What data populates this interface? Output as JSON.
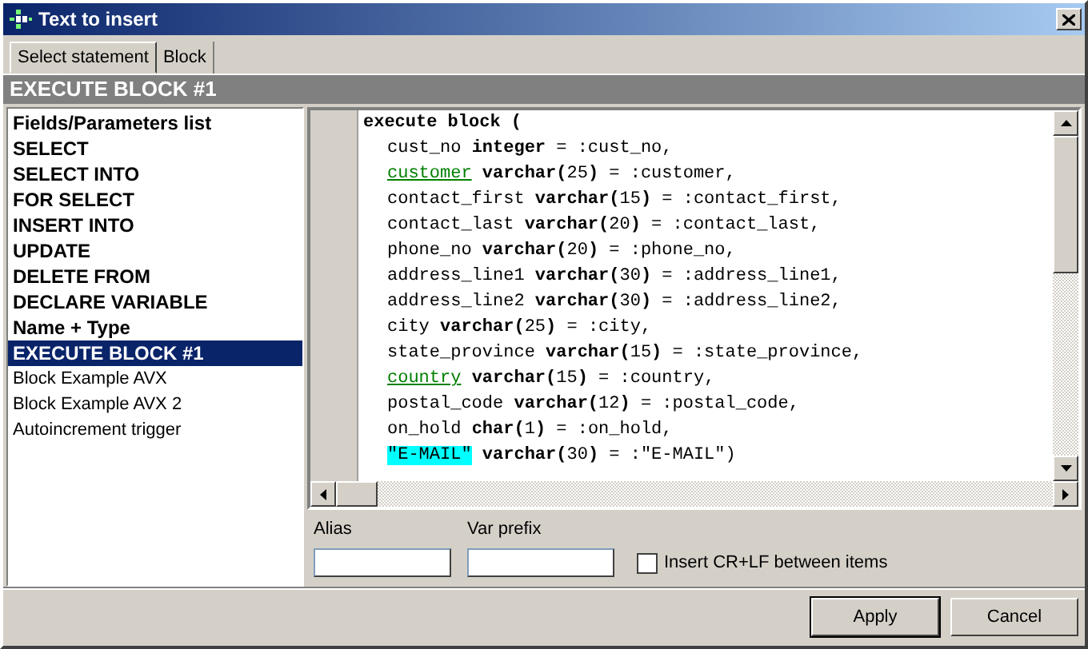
{
  "window": {
    "title": "Text to insert"
  },
  "tabs": [
    {
      "label": "Select statement",
      "selected": true
    },
    {
      "label": "Block",
      "selected": false
    }
  ],
  "header": "EXECUTE BLOCK #1",
  "templates": [
    {
      "label": "Fields/Parameters list",
      "kind": "builtin",
      "selected": false
    },
    {
      "label": "SELECT",
      "kind": "builtin",
      "selected": false
    },
    {
      "label": "SELECT INTO",
      "kind": "builtin",
      "selected": false
    },
    {
      "label": "FOR SELECT",
      "kind": "builtin",
      "selected": false
    },
    {
      "label": "INSERT INTO",
      "kind": "builtin",
      "selected": false
    },
    {
      "label": "UPDATE",
      "kind": "builtin",
      "selected": false
    },
    {
      "label": "DELETE FROM",
      "kind": "builtin",
      "selected": false
    },
    {
      "label": "DECLARE VARIABLE",
      "kind": "builtin",
      "selected": false
    },
    {
      "label": "Name + Type",
      "kind": "builtin",
      "selected": false
    },
    {
      "label": "EXECUTE BLOCK #1",
      "kind": "builtin",
      "selected": true
    },
    {
      "label": "Block Example AVX",
      "kind": "user",
      "selected": false
    },
    {
      "label": "Block Example AVX 2",
      "kind": "user",
      "selected": false
    },
    {
      "label": "Autoincrement trigger",
      "kind": "user",
      "selected": false
    }
  ],
  "code_lines": [
    {
      "indent": false,
      "parts": [
        {
          "kind": "keyword",
          "text": "execute block ("
        }
      ]
    },
    {
      "indent": true,
      "parts": [
        {
          "kind": "plain",
          "text": "cust_no "
        },
        {
          "kind": "keyword",
          "text": "integer"
        },
        {
          "kind": "plain",
          "text": " = :cust_no,"
        }
      ]
    },
    {
      "indent": true,
      "parts": [
        {
          "kind": "field",
          "text": "customer"
        },
        {
          "kind": "keyword",
          "text": " varchar("
        },
        {
          "kind": "plain",
          "text": "25"
        },
        {
          "kind": "keyword",
          "text": ")"
        },
        {
          "kind": "plain",
          "text": " = :customer,"
        }
      ]
    },
    {
      "indent": true,
      "parts": [
        {
          "kind": "plain",
          "text": "contact_first "
        },
        {
          "kind": "keyword",
          "text": "varchar("
        },
        {
          "kind": "plain",
          "text": "15"
        },
        {
          "kind": "keyword",
          "text": ")"
        },
        {
          "kind": "plain",
          "text": " = :contact_first,"
        }
      ]
    },
    {
      "indent": true,
      "parts": [
        {
          "kind": "plain",
          "text": "contact_last "
        },
        {
          "kind": "keyword",
          "text": "varchar("
        },
        {
          "kind": "plain",
          "text": "20"
        },
        {
          "kind": "keyword",
          "text": ")"
        },
        {
          "kind": "plain",
          "text": " = :contact_last,"
        }
      ]
    },
    {
      "indent": true,
      "parts": [
        {
          "kind": "plain",
          "text": "phone_no "
        },
        {
          "kind": "keyword",
          "text": "varchar("
        },
        {
          "kind": "plain",
          "text": "20"
        },
        {
          "kind": "keyword",
          "text": ")"
        },
        {
          "kind": "plain",
          "text": " = :phone_no,"
        }
      ]
    },
    {
      "indent": true,
      "parts": [
        {
          "kind": "plain",
          "text": "address_line1 "
        },
        {
          "kind": "keyword",
          "text": "varchar("
        },
        {
          "kind": "plain",
          "text": "30"
        },
        {
          "kind": "keyword",
          "text": ")"
        },
        {
          "kind": "plain",
          "text": " = :address_line1,"
        }
      ]
    },
    {
      "indent": true,
      "parts": [
        {
          "kind": "plain",
          "text": "address_line2 "
        },
        {
          "kind": "keyword",
          "text": "varchar("
        },
        {
          "kind": "plain",
          "text": "30"
        },
        {
          "kind": "keyword",
          "text": ")"
        },
        {
          "kind": "plain",
          "text": " = :address_line2,"
        }
      ]
    },
    {
      "indent": true,
      "parts": [
        {
          "kind": "plain",
          "text": "city "
        },
        {
          "kind": "keyword",
          "text": "varchar("
        },
        {
          "kind": "plain",
          "text": "25"
        },
        {
          "kind": "keyword",
          "text": ")"
        },
        {
          "kind": "plain",
          "text": " = :city,"
        }
      ]
    },
    {
      "indent": true,
      "parts": [
        {
          "kind": "plain",
          "text": "state_province "
        },
        {
          "kind": "keyword",
          "text": "varchar("
        },
        {
          "kind": "plain",
          "text": "15"
        },
        {
          "kind": "keyword",
          "text": ")"
        },
        {
          "kind": "plain",
          "text": " = :state_province,"
        }
      ]
    },
    {
      "indent": true,
      "parts": [
        {
          "kind": "field",
          "text": "country"
        },
        {
          "kind": "keyword",
          "text": " varchar("
        },
        {
          "kind": "plain",
          "text": "15"
        },
        {
          "kind": "keyword",
          "text": ")"
        },
        {
          "kind": "plain",
          "text": " = :country,"
        }
      ]
    },
    {
      "indent": true,
      "parts": [
        {
          "kind": "plain",
          "text": "postal_code "
        },
        {
          "kind": "keyword",
          "text": "varchar("
        },
        {
          "kind": "plain",
          "text": "12"
        },
        {
          "kind": "keyword",
          "text": ")"
        },
        {
          "kind": "plain",
          "text": " = :postal_code,"
        }
      ]
    },
    {
      "indent": true,
      "parts": [
        {
          "kind": "plain",
          "text": "on_hold "
        },
        {
          "kind": "keyword",
          "text": "char("
        },
        {
          "kind": "plain",
          "text": "1"
        },
        {
          "kind": "keyword",
          "text": ")"
        },
        {
          "kind": "plain",
          "text": " = :on_hold,"
        }
      ]
    },
    {
      "indent": true,
      "parts": [
        {
          "kind": "quoted",
          "text": "\"E-MAIL\""
        },
        {
          "kind": "keyword",
          "text": " varchar("
        },
        {
          "kind": "plain",
          "text": "30"
        },
        {
          "kind": "keyword",
          "text": ")"
        },
        {
          "kind": "plain",
          "text": " = :\"E-MAIL\")"
        }
      ]
    }
  ],
  "alias": {
    "label": "Alias"
  },
  "var_prefix": {
    "label": "Var prefix"
  },
  "crlf_option": {
    "label": "Insert CR+LF between items",
    "checked": false
  },
  "buttons": [
    {
      "label": "Apply",
      "kind": "default"
    },
    {
      "label": "Cancel",
      "kind": "normal"
    }
  ]
}
